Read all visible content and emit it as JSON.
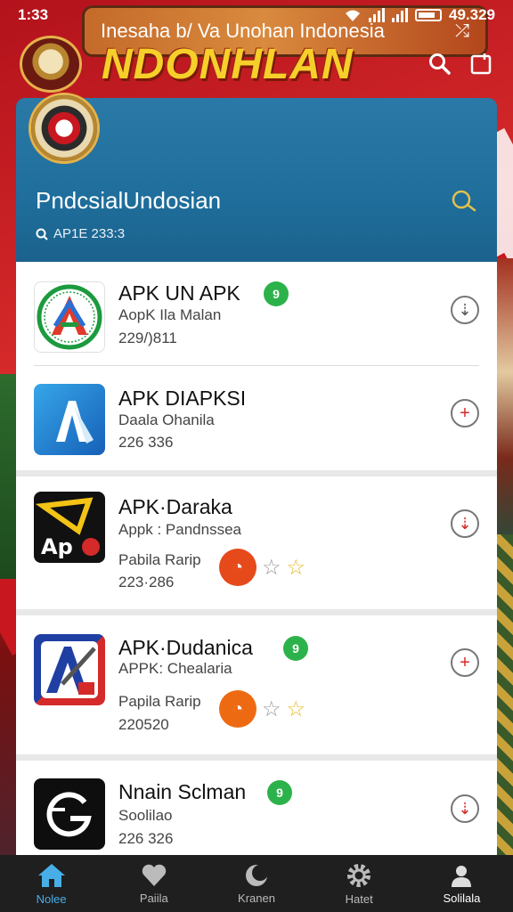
{
  "status_bar": {
    "time": "1:33",
    "right_text": "49.329"
  },
  "header": {
    "title": "NDONHLAN",
    "emblem_icon": "garuda-emblem-icon",
    "search_icon": "search-icon",
    "window_icon": "window-icon"
  },
  "promo": {
    "text": "Inesaha b/ Va Unohan Indonesia",
    "icon": "shuffle-icon"
  },
  "section": {
    "title": "PndcsialUndosian",
    "search_text": "AP1E 233:3",
    "icon": "search-icon"
  },
  "apps": [
    {
      "name": "APK UN APK",
      "sub": "AopK Ila Malan",
      "meta": "229/)811",
      "badge": "9",
      "action": "download"
    },
    {
      "name": "APK DIAPKSI",
      "sub": "Daala Ohanila",
      "meta": "226 336",
      "action": "add"
    },
    {
      "name": "APK·Daraka",
      "sub": "Appk : Pandnssea",
      "meta_label": "Pabila Rarip",
      "meta": "223·286",
      "logo_text": "Ap",
      "action": "download"
    },
    {
      "name": "APK·Dudanica",
      "sub": "APPK: Chealaria",
      "meta_label": "Papila Rarip",
      "meta": "220520",
      "badge": "9",
      "action": "add"
    },
    {
      "name": "Nnain Sclman",
      "sub": "Soolilao",
      "meta": "226 326",
      "badge": "9",
      "action": "download"
    }
  ],
  "nav": [
    {
      "label": "Nolee",
      "icon": "home-icon"
    },
    {
      "label": "Paiila",
      "icon": "heart-icon"
    },
    {
      "label": "Kranen",
      "icon": "moon-icon"
    },
    {
      "label": "Hatet",
      "icon": "gear-icon"
    },
    {
      "label": "Solilala",
      "icon": "person-icon"
    }
  ],
  "colors": {
    "accent_blue": "#1f6e9c",
    "title_yellow": "#f7cf2a",
    "badge_green": "#2cb24a",
    "nav_active": "#48aee8",
    "flag_red": "#c8171f"
  }
}
